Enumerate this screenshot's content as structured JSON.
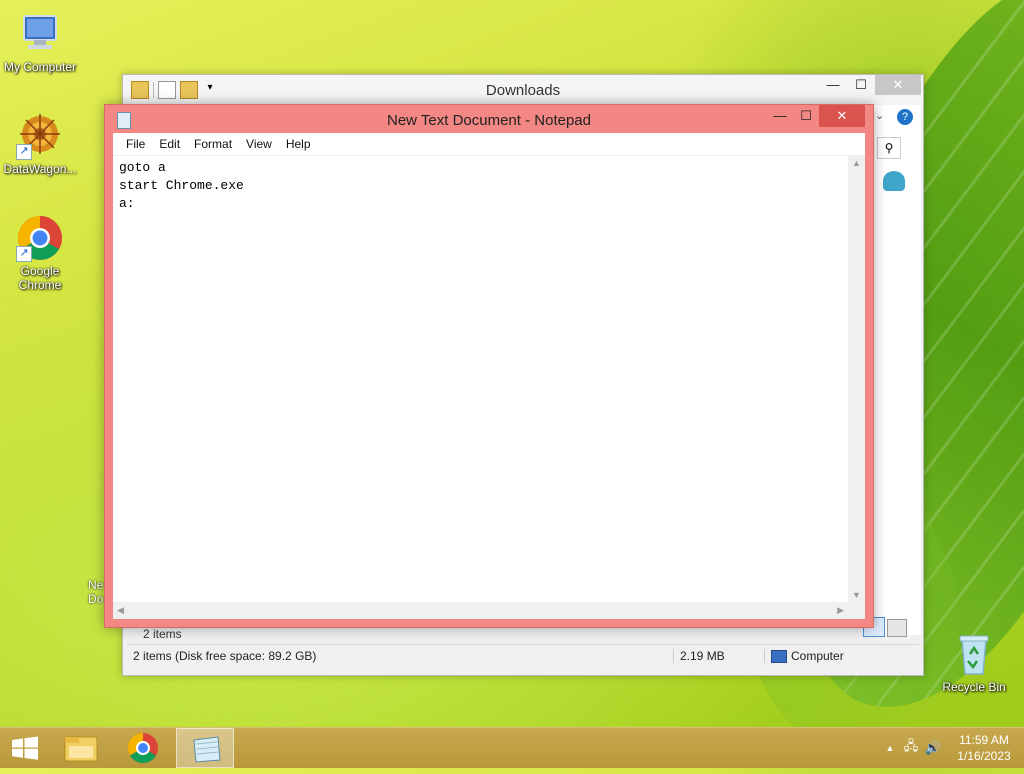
{
  "desktop": {
    "icons": [
      {
        "label": "My Computer"
      },
      {
        "label": "DataWagon..."
      },
      {
        "label": "Google Chrome"
      },
      {
        "label": "Recycle Bin"
      }
    ],
    "partial_icon_labels": [
      "Ne",
      "Do"
    ]
  },
  "explorer": {
    "title": "Downloads",
    "items_count": "2 items",
    "status": {
      "items_info": "2 items (Disk free space: 89.2 GB)",
      "size": "2.19 MB",
      "location": "Computer"
    },
    "buttons": {
      "minimize": "—",
      "maximize": "☐",
      "close": "✕"
    }
  },
  "notepad": {
    "title": "New Text Document - Notepad",
    "menu": [
      "File",
      "Edit",
      "Format",
      "View",
      "Help"
    ],
    "content": "goto a\nstart Chrome.exe\na:",
    "buttons": {
      "minimize": "—",
      "maximize": "☐",
      "close": "✕"
    }
  },
  "taskbar": {
    "clock_time": "11:59 AM",
    "clock_date": "1/16/2023",
    "items": [
      "start-button",
      "file-explorer-icon",
      "chrome-icon",
      "notepad-icon"
    ],
    "colors": {
      "taskbar": "#b8983a",
      "notepad_frame": "#f28783",
      "close_red": "#d9534f"
    }
  }
}
